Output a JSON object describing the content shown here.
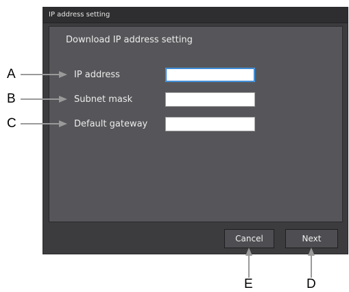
{
  "window": {
    "title": "IP address setting"
  },
  "panel": {
    "heading": "Download IP address setting",
    "fields": [
      {
        "label": "IP address",
        "value": ""
      },
      {
        "label": "Subnet mask",
        "value": ""
      },
      {
        "label": "Default gateway",
        "value": ""
      }
    ]
  },
  "buttons": {
    "cancel": "Cancel",
    "next": "Next"
  },
  "callouts": {
    "a": "A",
    "b": "B",
    "c": "C",
    "d": "D",
    "e": "E"
  },
  "colors": {
    "dialog_bg": "#3c3c3e",
    "panel_bg": "#56565a",
    "focus_border": "#4f9be0",
    "callout_arrow": "#9a9a9a"
  }
}
